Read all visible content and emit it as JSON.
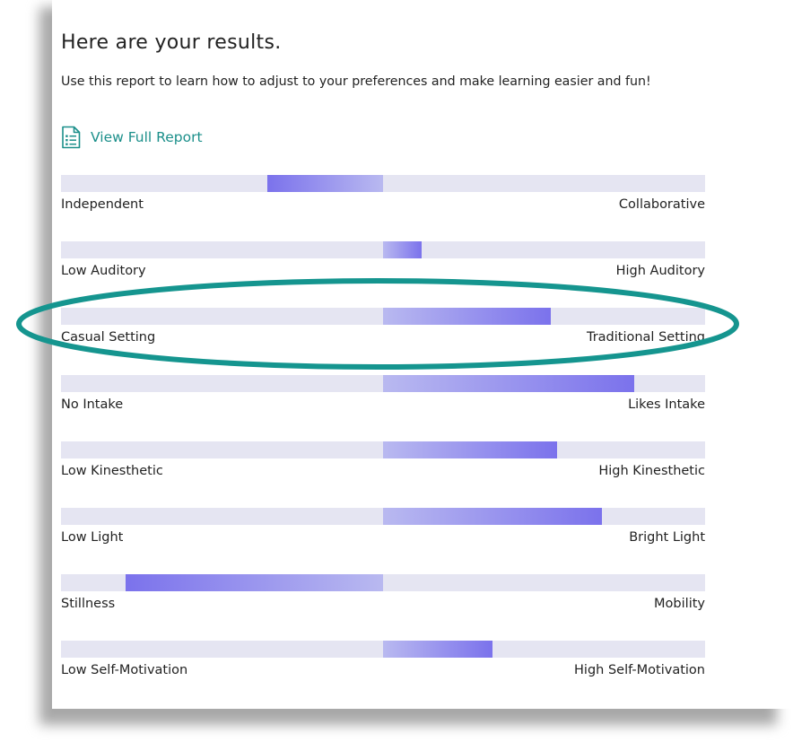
{
  "header": {
    "title": "Here are your results.",
    "subtitle": "Use this report to learn how to adjust to your preferences and make learning easier and fun!"
  },
  "report_link": {
    "label": "View Full Report",
    "icon": "report-document-icon"
  },
  "colors": {
    "track": "#e5e5f2",
    "fill_light": "#b9b9f0",
    "fill_strong": "#7b72ec",
    "link": "#1b8f8a",
    "highlight": "#15958f"
  },
  "scales": [
    {
      "left_label": "Independent",
      "right_label": "Collaborative",
      "value": -0.36
    },
    {
      "left_label": "Low Auditory",
      "right_label": "High Auditory",
      "value": 0.12
    },
    {
      "left_label": "Casual Setting",
      "right_label": "Traditional Setting",
      "value": 0.52,
      "highlighted": true
    },
    {
      "left_label": "No Intake",
      "right_label": "Likes Intake",
      "value": 0.78
    },
    {
      "left_label": "Low Kinesthetic",
      "right_label": "High Kinesthetic",
      "value": 0.54
    },
    {
      "left_label": "Low Light",
      "right_label": "Bright Light",
      "value": 0.68
    },
    {
      "left_label": "Stillness",
      "right_label": "Mobility",
      "value": -0.8
    },
    {
      "left_label": "Low Self-Motivation",
      "right_label": "High Self-Motivation",
      "value": 0.34
    }
  ]
}
